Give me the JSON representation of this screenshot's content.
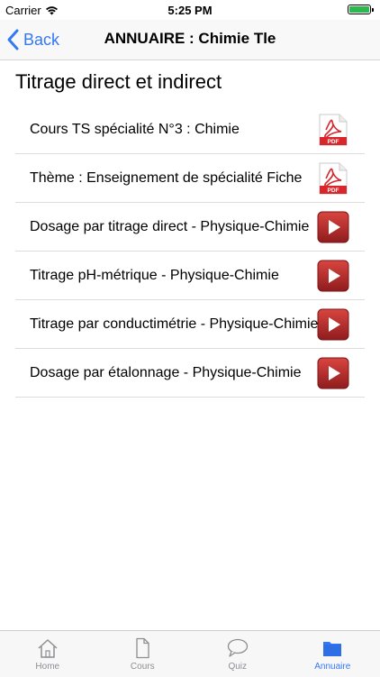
{
  "status_bar": {
    "carrier": "Carrier",
    "time": "5:25 PM",
    "battery_level": 1.0
  },
  "nav": {
    "back_label": "Back",
    "title": "ANNUAIRE : Chimie Tle"
  },
  "section": {
    "title": "Titrage direct et indirect"
  },
  "items": [
    {
      "label": "Cours TS spécialité N°3 : Chimie",
      "icon": "pdf-icon"
    },
    {
      "label": "Thème : Enseignement de spécialité Fiche",
      "icon": "pdf-icon"
    },
    {
      "label": "Dosage par titrage direct - Physique-Chimie",
      "icon": "video-play-icon"
    },
    {
      "label": "Titrage pH-métrique - Physique-Chimie",
      "icon": "video-play-icon"
    },
    {
      "label": "Titrage par conductimétrie - Physique-Chimie",
      "icon": "video-play-icon"
    },
    {
      "label": "Dosage par étalonnage - Physique-Chimie",
      "icon": "video-play-icon"
    }
  ],
  "pdf_badge_text": "PDF",
  "colors": {
    "accent": "#3478f6",
    "pdf_red": "#d8262b",
    "video_red": "#b3262a",
    "tab_inactive": "#8e8e93"
  },
  "tabs": [
    {
      "label": "Home",
      "icon": "home-icon",
      "active": false
    },
    {
      "label": "Cours",
      "icon": "document-icon",
      "active": false
    },
    {
      "label": "Quiz",
      "icon": "chat-bubble-icon",
      "active": false
    },
    {
      "label": "Annuaire",
      "icon": "folder-icon",
      "active": true
    }
  ]
}
